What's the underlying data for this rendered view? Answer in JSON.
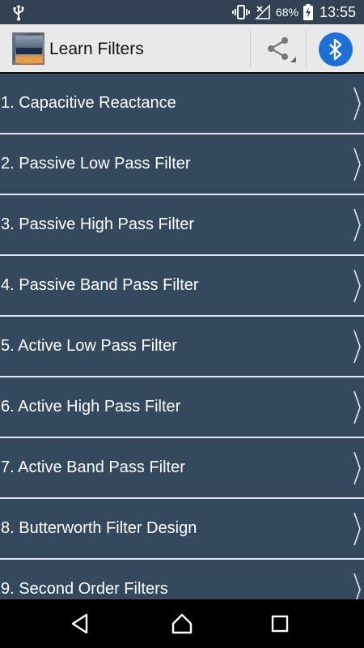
{
  "status_bar": {
    "battery_percent": "68%",
    "time": "13:55"
  },
  "app_bar": {
    "title": "Learn Filters",
    "logo_text": "Learn FILTERS"
  },
  "list": {
    "items": [
      {
        "label": "1. Capacitive Reactance"
      },
      {
        "label": "2. Passive Low Pass Filter"
      },
      {
        "label": "3. Passive High Pass Filter"
      },
      {
        "label": "4. Passive Band Pass Filter"
      },
      {
        "label": "5. Active Low Pass Filter"
      },
      {
        "label": "6. Active High Pass Filter"
      },
      {
        "label": "7. Active Band Pass Filter"
      },
      {
        "label": "8. Butterworth Filter Design"
      },
      {
        "label": "9. Second Order Filters"
      }
    ]
  },
  "icons": {
    "usb": "usb-icon",
    "vibrate": "vibrate-icon",
    "no_signal": "no-signal-icon",
    "battery": "battery-charging-icon",
    "share": "share-icon",
    "bluetooth": "bluetooth-icon",
    "chevron": "chevron-right-icon",
    "back": "back-icon",
    "home": "home-icon",
    "recents": "recents-icon"
  },
  "colors": {
    "list_background": "#34495e",
    "divider": "#dfe5ea",
    "app_bar": "#e9e9e9",
    "status_bar": "#334155",
    "bluetooth_accent": "#1e6fd6"
  }
}
